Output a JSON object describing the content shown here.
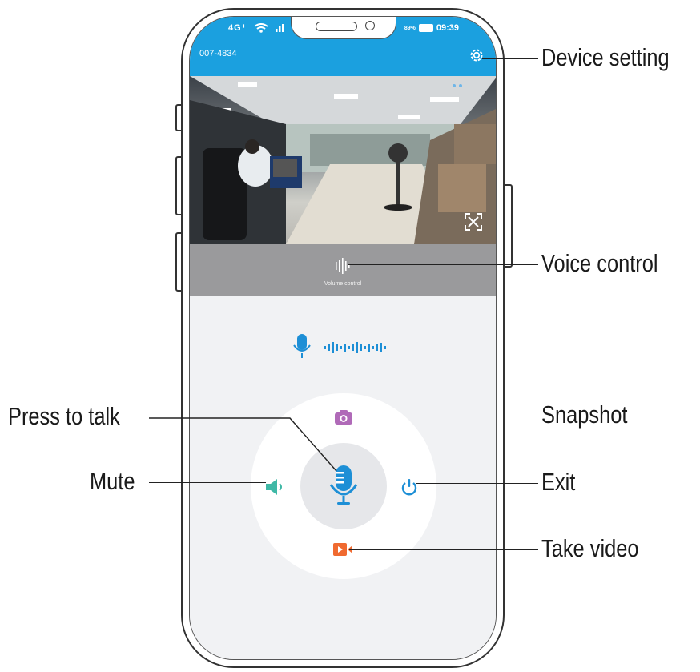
{
  "status_bar": {
    "signal": "4G⁺",
    "battery_pct": "89%",
    "time": "09:39"
  },
  "device": {
    "id": "007-4834"
  },
  "video": {
    "volume_label": "Volume control"
  },
  "callouts": {
    "device_setting": "Device setting",
    "voice_control": "Voice control",
    "press_to_talk": "Press to talk",
    "snapshot": "Snapshot",
    "mute": "Mute",
    "exit": "Exit",
    "take_video": "Take video"
  },
  "colors": {
    "app_blue": "#1ba0df",
    "mic_blue": "#1d8fd6",
    "snapshot_purple": "#b06ab8",
    "mute_teal": "#3fb8a6",
    "video_orange": "#f06a30"
  }
}
